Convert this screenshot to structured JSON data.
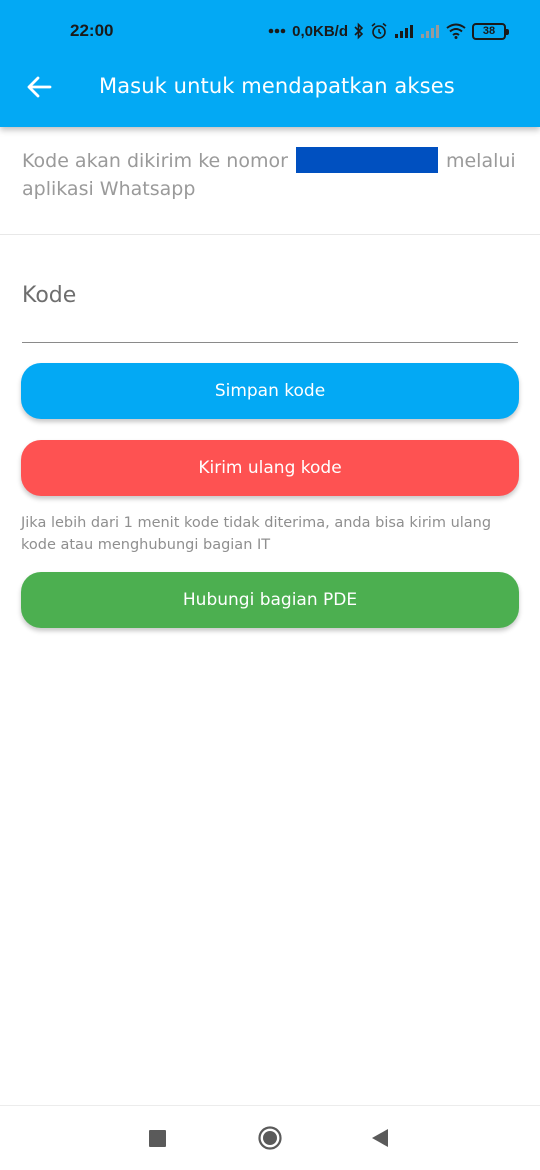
{
  "status_bar": {
    "time": "22:00",
    "network_speed": "0,0KB/d",
    "battery": "38",
    "icons": [
      "dots-icon",
      "bluetooth-icon",
      "alarm-icon",
      "signal-icon",
      "signal-icon-2",
      "wifi-icon",
      "battery-icon"
    ]
  },
  "app_bar": {
    "back_icon": "arrow-left-icon",
    "title": "Masuk untuk mendapatkan akses",
    "color": "#03a9f4"
  },
  "info": {
    "text_before": "Kode akan dikirim ke nomor ",
    "text_after": " melalui aplikasi Whatsapp"
  },
  "code_input": {
    "placeholder": "Kode",
    "value": ""
  },
  "buttons": {
    "save_label": "Simpan kode",
    "resend_label": "Kirim ulang kode",
    "contact_label": "Hubungi bagian PDE"
  },
  "hint": "Jika lebih dari 1 menit kode tidak diterima, anda bisa kirim ulang kode atau menghubungi bagian IT",
  "colors": {
    "primary": "#03a9f4",
    "danger": "#fe5252",
    "success": "#4caf50"
  },
  "nav_bar": {
    "icons": [
      "recents-square-icon",
      "home-circle-icon",
      "back-triangle-icon"
    ]
  }
}
